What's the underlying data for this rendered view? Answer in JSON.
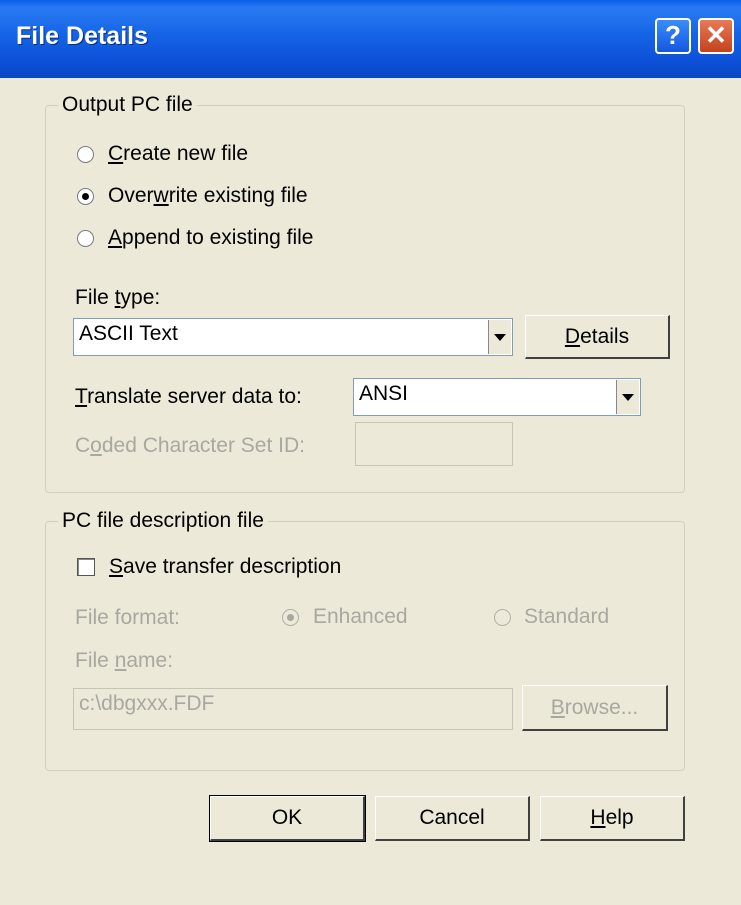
{
  "window": {
    "title": "File Details"
  },
  "output_group": {
    "legend": "Output PC file",
    "radios": [
      {
        "pre": "",
        "u": "C",
        "post": "reate new file",
        "selected": false
      },
      {
        "pre": "Over",
        "u": "w",
        "post": "rite existing file",
        "selected": true
      },
      {
        "pre": "",
        "u": "A",
        "post": "ppend to existing file",
        "selected": false
      }
    ],
    "file_type_label": {
      "pre": "File ",
      "u": "t",
      "post": "ype:"
    },
    "file_type_value": "ASCII Text",
    "details_button": {
      "pre": "",
      "u": "D",
      "post": "etails"
    },
    "translate_label": {
      "pre": "",
      "u": "T",
      "post": "ranslate server data to:"
    },
    "translate_value": "ANSI",
    "ccsid_label": {
      "pre": "C",
      "u": "o",
      "post": "ded Character Set ID:"
    },
    "ccsid_value": ""
  },
  "description_group": {
    "legend": "PC file description file",
    "save_checkbox": {
      "pre": "",
      "u": "S",
      "post": "ave transfer description",
      "checked": false
    },
    "format_label": "File format:",
    "format_enhanced": "Enhanced",
    "format_standard": "Standard",
    "file_name_label": {
      "pre": "File ",
      "u": "n",
      "post": "ame:"
    },
    "file_name_value": "c:\\dbgxxx.FDF",
    "browse_button": {
      "pre": "",
      "u": "B",
      "post": "rowse..."
    }
  },
  "footer": {
    "ok": "OK",
    "cancel": "Cancel",
    "help": {
      "pre": "",
      "u": "H",
      "post": "elp"
    }
  }
}
